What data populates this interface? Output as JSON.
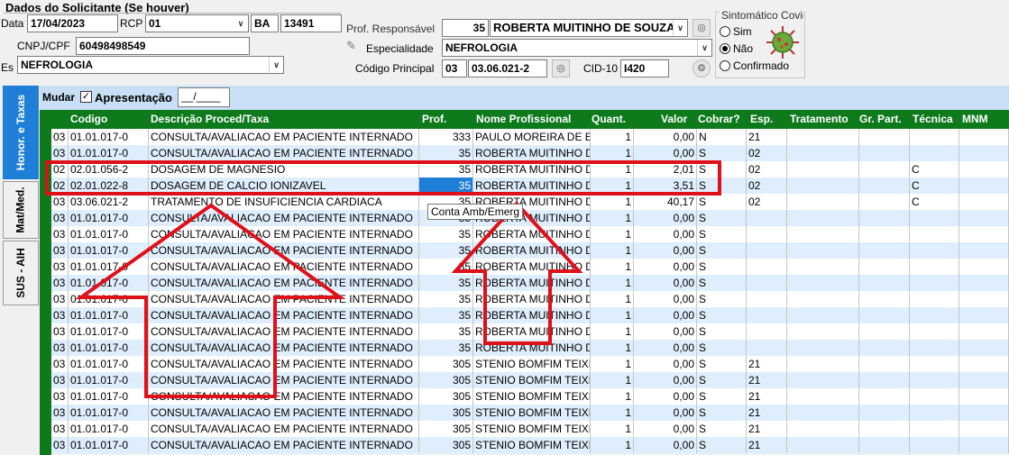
{
  "solicitante": {
    "section_title": "Dados do Solicitante (Se houver)",
    "data_label": "Data",
    "data_value": "17/04/2023",
    "rcp_label": "RCP",
    "rcp_value": "01",
    "uf_value": "BA",
    "rcp_number": "13491",
    "cnpj_label": "CNPJ/CPF",
    "cnpj_value": "60498498549",
    "esp_label": "Es",
    "esp_value": "NEFROLOGIA"
  },
  "profissional": {
    "prof_label": "Prof. Responsável",
    "prof_code": "35",
    "prof_name": "ROBERTA MUITINHO DE SOUZA",
    "especialidade_label": "Especialidade",
    "especialidade_value": "NEFROLOGIA",
    "codigo_label": "Código Principal",
    "codigo_group": "03",
    "codigo_value": "03.06.021-2",
    "cid_label": "CID-10",
    "cid_value": "I420"
  },
  "covid": {
    "title": "Sintomático Covid",
    "options": [
      "Sim",
      "Não",
      "Confirmado"
    ],
    "selected": "Não"
  },
  "tabs": [
    "Honor. e Taxas",
    "Mat/Med.",
    "SUS - AIH"
  ],
  "toolbar": {
    "mudar_label": "Mudar",
    "apresentacao_label": "Apresentação",
    "apresentacao_value": "__/____"
  },
  "columns": [
    "Codigo",
    "Descrição Proced/Taxa",
    "Prof.",
    "Nome Profissional",
    "Quant.",
    "Valor",
    "Cobrar?",
    "Esp.",
    "Tratamento",
    "Gr. Part.",
    "Técnica",
    "MNM"
  ],
  "rows": [
    {
      "grp": "03",
      "codigo": "01.01.017-0",
      "desc": "CONSULTA/AVALIACAO EM PACIENTE INTERNADO",
      "prof": "333",
      "nome": "PAULO MOREIRA DE E",
      "quant": "1",
      "valor": "0,00",
      "cobrar": "N",
      "esp": "21",
      "tecnica": ""
    },
    {
      "grp": "03",
      "codigo": "01.01.017-0",
      "desc": "CONSULTA/AVALIACAO EM PACIENTE INTERNADO",
      "prof": "35",
      "nome": "ROBERTA MUITINHO D",
      "quant": "1",
      "valor": "0,00",
      "cobrar": "S",
      "esp": "02",
      "tecnica": ""
    },
    {
      "grp": "02",
      "codigo": "02.01.056-2",
      "desc": "DOSAGEM DE MAGNESIO",
      "prof": "35",
      "nome": "ROBERTA MUITINHO D",
      "quant": "1",
      "valor": "2,01",
      "cobrar": "S",
      "esp": "02",
      "tecnica": "C"
    },
    {
      "grp": "02",
      "codigo": "02.01.022-8",
      "desc": "DOSAGEM DE CALCIO IONIZAVEL",
      "prof": "35",
      "nome": "ROBERTA MUITINHO D",
      "quant": "1",
      "valor": "3,51",
      "cobrar": "S",
      "esp": "02",
      "tecnica": "C"
    },
    {
      "grp": "03",
      "codigo": "03.06.021-2",
      "desc": "TRATAMENTO DE INSUFICIENCIA CARDIACA",
      "prof": "35",
      "nome": "ROBERTA MUITINHO D",
      "quant": "1",
      "valor": "40,17",
      "cobrar": "S",
      "esp": "02",
      "tecnica": "C"
    },
    {
      "grp": "03",
      "codigo": "01.01.017-0",
      "desc": "CONSULTA/AVALIACAO EM PACIENTE INTERNADO",
      "prof": "35",
      "nome": "ROBERTA MUITINHO D",
      "quant": "1",
      "valor": "0,00",
      "cobrar": "S",
      "esp": "",
      "tecnica": ""
    },
    {
      "grp": "03",
      "codigo": "01.01.017-0",
      "desc": "CONSULTA/AVALIACAO EM PACIENTE INTERNADO",
      "prof": "35",
      "nome": "ROBERTA MUITINHO D",
      "quant": "1",
      "valor": "0,00",
      "cobrar": "S",
      "esp": "",
      "tecnica": ""
    },
    {
      "grp": "03",
      "codigo": "01.01.017-0",
      "desc": "CONSULTA/AVALIACAO EM PACIENTE INTERNADO",
      "prof": "35",
      "nome": "ROBERTA MUITINHO D",
      "quant": "1",
      "valor": "0,00",
      "cobrar": "S",
      "esp": "",
      "tecnica": ""
    },
    {
      "grp": "03",
      "codigo": "01.01.017-0",
      "desc": "CONSULTA/AVALIACAO EM PACIENTE INTERNADO",
      "prof": "35",
      "nome": "ROBERTA MUITINHO D",
      "quant": "1",
      "valor": "0,00",
      "cobrar": "S",
      "esp": "",
      "tecnica": ""
    },
    {
      "grp": "03",
      "codigo": "01.01.017-0",
      "desc": "CONSULTA/AVALIACAO EM PACIENTE INTERNADO",
      "prof": "35",
      "nome": "ROBERTA MUITINHO D",
      "quant": "1",
      "valor": "0,00",
      "cobrar": "S",
      "esp": "",
      "tecnica": ""
    },
    {
      "grp": "03",
      "codigo": "01.01.017-0",
      "desc": "CONSULTA/AVALIACAO EM PACIENTE INTERNADO",
      "prof": "35",
      "nome": "ROBERTA MUITINHO D",
      "quant": "1",
      "valor": "0,00",
      "cobrar": "S",
      "esp": "",
      "tecnica": ""
    },
    {
      "grp": "03",
      "codigo": "01.01.017-0",
      "desc": "CONSULTA/AVALIACAO EM PACIENTE INTERNADO",
      "prof": "35",
      "nome": "ROBERTA MUITINHO D",
      "quant": "1",
      "valor": "0,00",
      "cobrar": "S",
      "esp": "",
      "tecnica": ""
    },
    {
      "grp": "03",
      "codigo": "01.01.017-0",
      "desc": "CONSULTA/AVALIACAO EM PACIENTE INTERNADO",
      "prof": "35",
      "nome": "ROBERTA MUITINHO D",
      "quant": "1",
      "valor": "0,00",
      "cobrar": "S",
      "esp": "",
      "tecnica": ""
    },
    {
      "grp": "03",
      "codigo": "01.01.017-0",
      "desc": "CONSULTA/AVALIACAO EM PACIENTE INTERNADO",
      "prof": "35",
      "nome": "ROBERTA MUITINHO D",
      "quant": "1",
      "valor": "0,00",
      "cobrar": "S",
      "esp": "",
      "tecnica": ""
    },
    {
      "grp": "03",
      "codigo": "01.01.017-0",
      "desc": "CONSULTA/AVALIACAO EM PACIENTE INTERNADO",
      "prof": "305",
      "nome": "STENIO BOMFIM TEIXE",
      "quant": "1",
      "valor": "0,00",
      "cobrar": "S",
      "esp": "21",
      "tecnica": ""
    },
    {
      "grp": "03",
      "codigo": "01.01.017-0",
      "desc": "CONSULTA/AVALIACAO EM PACIENTE INTERNADO",
      "prof": "305",
      "nome": "STENIO BOMFIM TEIXE",
      "quant": "1",
      "valor": "0,00",
      "cobrar": "S",
      "esp": "21",
      "tecnica": ""
    },
    {
      "grp": "03",
      "codigo": "01.01.017-0",
      "desc": "CONSULTA/AVALIACAO EM PACIENTE INTERNADO",
      "prof": "305",
      "nome": "STENIO BOMFIM TEIXE",
      "quant": "1",
      "valor": "0,00",
      "cobrar": "S",
      "esp": "21",
      "tecnica": ""
    },
    {
      "grp": "03",
      "codigo": "01.01.017-0",
      "desc": "CONSULTA/AVALIACAO EM PACIENTE INTERNADO",
      "prof": "305",
      "nome": "STENIO BOMFIM TEIXE",
      "quant": "1",
      "valor": "0,00",
      "cobrar": "S",
      "esp": "21",
      "tecnica": ""
    },
    {
      "grp": "03",
      "codigo": "01.01.017-0",
      "desc": "CONSULTA/AVALIACAO EM PACIENTE INTERNADO",
      "prof": "305",
      "nome": "STENIO BOMFIM TEIXE",
      "quant": "1",
      "valor": "0,00",
      "cobrar": "S",
      "esp": "21",
      "tecnica": ""
    },
    {
      "grp": "03",
      "codigo": "01.01.017-0",
      "desc": "CONSULTA/AVALIACAO EM PACIENTE INTERNADO",
      "prof": "305",
      "nome": "STENIO BOMFIM TEIXE",
      "quant": "1",
      "valor": "0,00",
      "cobrar": "S",
      "esp": "21",
      "tecnica": ""
    }
  ],
  "tooltip": "Conta Amb/Emerg",
  "colors": {
    "grid_header": "#0e7a1c",
    "row_alt": "#dfeefc",
    "selection": "#1f7fd6",
    "annotation": "#e0101a"
  }
}
